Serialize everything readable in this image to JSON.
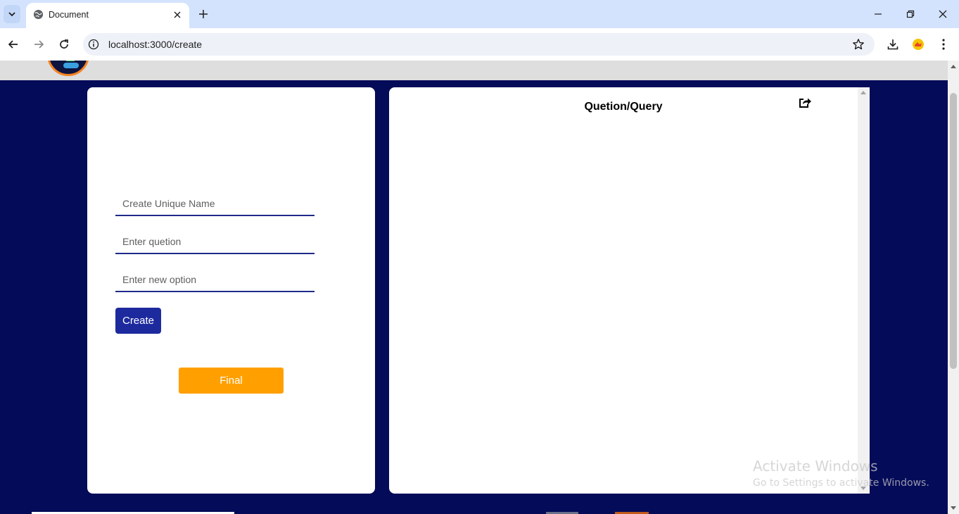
{
  "browser": {
    "tab_title": "Document",
    "url": "localhost:3000/create"
  },
  "form": {
    "name_placeholder": "Create Unique Name",
    "question_placeholder": "Enter quetion",
    "option_placeholder": "Enter new option",
    "create_label": "Create",
    "final_label": "Final"
  },
  "preview": {
    "title": "Quetion/Query"
  },
  "watermark": {
    "title": "Activate Windows",
    "subtitle": "Go to Settings to activate Windows."
  },
  "colors": {
    "page_background": "#040b58",
    "create_button": "#1d2a9e",
    "final_button": "#ffa000",
    "input_underline": "#1f2a8a"
  },
  "icons": [
    "tab-list-chevron-icon",
    "globe-icon",
    "close-icon",
    "plus-icon",
    "minimize-icon",
    "restore-icon",
    "back-arrow-icon",
    "forward-arrow-icon",
    "reload-icon",
    "info-icon",
    "star-icon",
    "download-icon",
    "extension-icon",
    "kebab-menu-icon",
    "share-icon"
  ]
}
